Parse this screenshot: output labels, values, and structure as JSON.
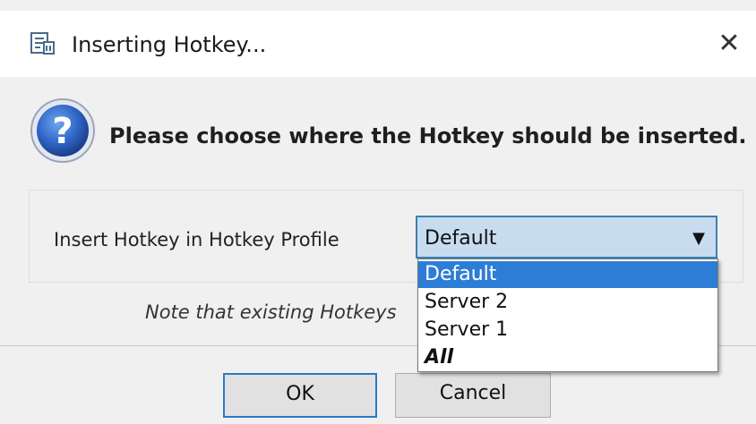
{
  "window": {
    "title": "Inserting Hotkey...",
    "close_glyph": "✕",
    "app_icon": "hotkey-app-icon"
  },
  "message": {
    "icon": "question-icon",
    "text": "Please choose where the Hotkey should be inserted."
  },
  "profile_select": {
    "label": "Insert Hotkey in Hotkey Profile",
    "value": "Default",
    "arrow_glyph": "▼",
    "options": [
      "Default",
      "Server 2",
      "Server 1",
      "All"
    ],
    "highlighted_index": 0
  },
  "note": {
    "text": "Note that existing Hotkeys"
  },
  "buttons": {
    "ok": "OK",
    "cancel": "Cancel"
  },
  "colors": {
    "select_bg": "#c7ddef",
    "select_border": "#3c7fb1",
    "highlight": "#2c7dd6",
    "ok_border": "#2b78c9"
  }
}
